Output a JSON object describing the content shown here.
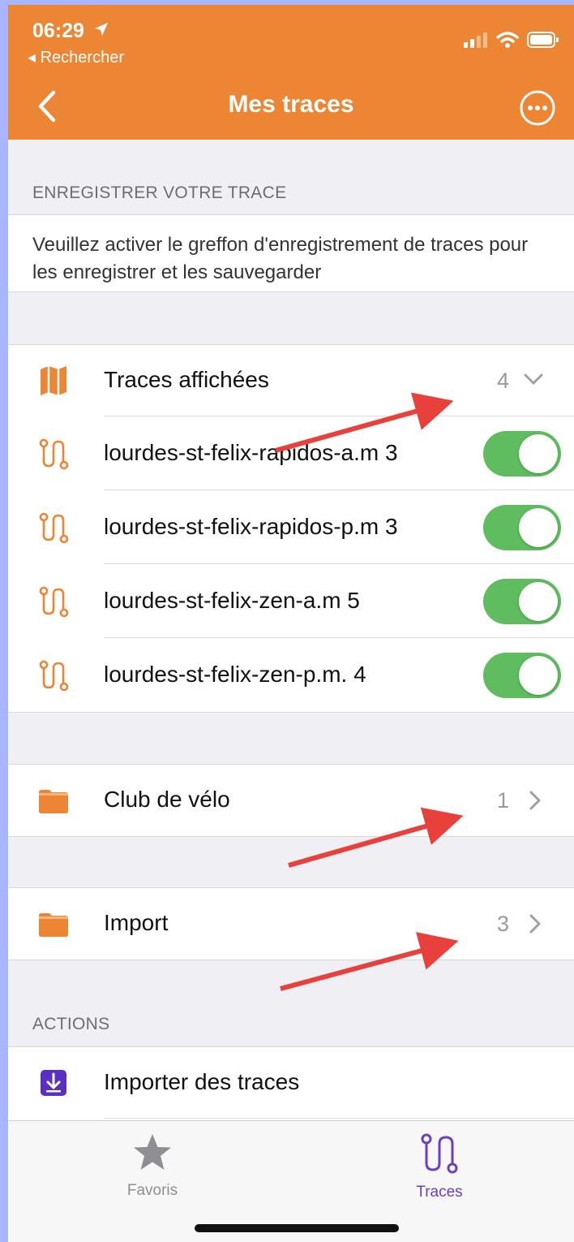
{
  "status": {
    "time": "06:29",
    "back_app": "◂ Rechercher"
  },
  "nav": {
    "title": "Mes traces"
  },
  "record_section": {
    "header": "ENREGISTRER VOTRE TRACE",
    "description": "Veuillez activer le greffon d'enregistrement de traces pour les enregistrer et les sauvegarder"
  },
  "displayed": {
    "label": "Traces affichées",
    "count": "4",
    "tracks": [
      {
        "name": "lourdes-st-felix-rapidos-a.m 3",
        "enabled": true
      },
      {
        "name": "lourdes-st-felix-rapidos-p.m 3",
        "enabled": true
      },
      {
        "name": "lourdes-st-felix-zen-a.m 5",
        "enabled": true
      },
      {
        "name": "lourdes-st-felix-zen-p.m. 4",
        "enabled": true
      }
    ]
  },
  "folders": [
    {
      "name": "Club de vélo",
      "count": "1"
    },
    {
      "name": "Import",
      "count": "3"
    }
  ],
  "actions": {
    "header": "ACTIONS",
    "import_label": "Importer des traces"
  },
  "tabbar": {
    "favoris": "Favoris",
    "traces": "Traces"
  },
  "colors": {
    "accent": "#ec8534",
    "toggle_on": "#5fbd5f",
    "active_tab": "#6a3fc8",
    "annotation_arrow": "#e8413c"
  }
}
